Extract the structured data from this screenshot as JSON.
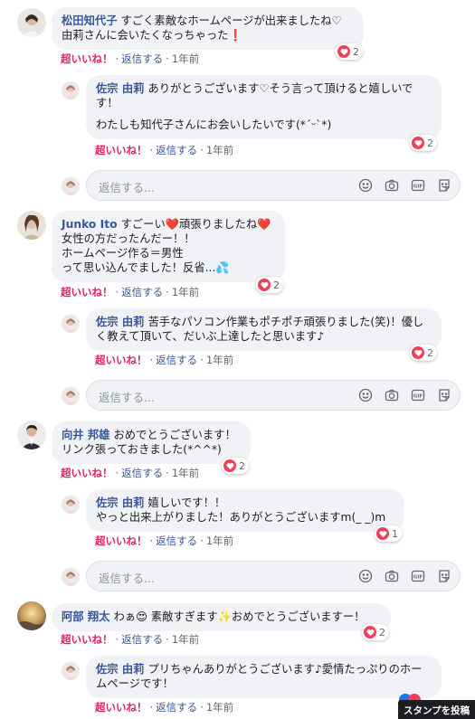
{
  "labels": {
    "like": "超いいね！",
    "reply": "返信する",
    "dot": "·",
    "reply_placeholder": "返信する..."
  },
  "colors": {
    "link": "#385898",
    "like": "#e0245e",
    "heart": "#f33e58",
    "bubble": "#f0f2f5"
  },
  "threads": [
    {
      "author": "松田知代子",
      "lines": [
        "すごく素敵なホームページが出来ましたね♡",
        "由莉さんに会いたくなっちゃった❗"
      ],
      "reactions": "2",
      "time": "1年前",
      "reply": {
        "author": "佐宗 由莉",
        "lines": [
          "ありがとうございます♡そう言って頂けると嬉しいです！",
          "",
          "わたしも知代子さんにお会いしたいです(*´ᵕ`*)"
        ],
        "reactions": "2",
        "time": "1年前"
      }
    },
    {
      "author": "Junko Ito",
      "lines": [
        "すごーい❤️頑張りましたね❤️",
        "女性の方だったんだー！！",
        "ホームページ作る＝男性",
        "って思い込んでました！反省...💦"
      ],
      "reactions": "2",
      "time": "1年前",
      "reply": {
        "author": "佐宗 由莉",
        "lines": [
          "苦手なパソコン作業もポチポチ頑張りました(笑)！優しく教えて頂いて、だいぶ上達したと思います♪"
        ],
        "reactions": "2",
        "time": "1年前"
      }
    },
    {
      "author": "向井 邦雄",
      "lines": [
        "おめでとうございます！",
        "リンク張っておきました(*^^*)"
      ],
      "reactions": "2",
      "time": "1年前",
      "reply": {
        "author": "佐宗 由莉",
        "lines": [
          "嬉しいです！！",
          "やっと出来上がりました！ありがとうございますm(_ _)m"
        ],
        "reactions": "1",
        "time": "1年前"
      }
    },
    {
      "author": "阿部 翔太",
      "lines": [
        "わぁ😍 素敵すぎます✨おめでとうございますー！"
      ],
      "reactions": "2",
      "time": "1年前",
      "reply": {
        "author": "佐宗 由莉",
        "lines": [
          "プリちゃんありがとうございます♪愛情たっぷりのホームページです！"
        ],
        "reactions": "",
        "time": "1年前"
      }
    }
  ],
  "tooltip": {
    "text": "スタンプを投稿"
  },
  "icons": [
    "smiley-icon",
    "camera-icon",
    "gif-icon",
    "sticker-icon"
  ]
}
